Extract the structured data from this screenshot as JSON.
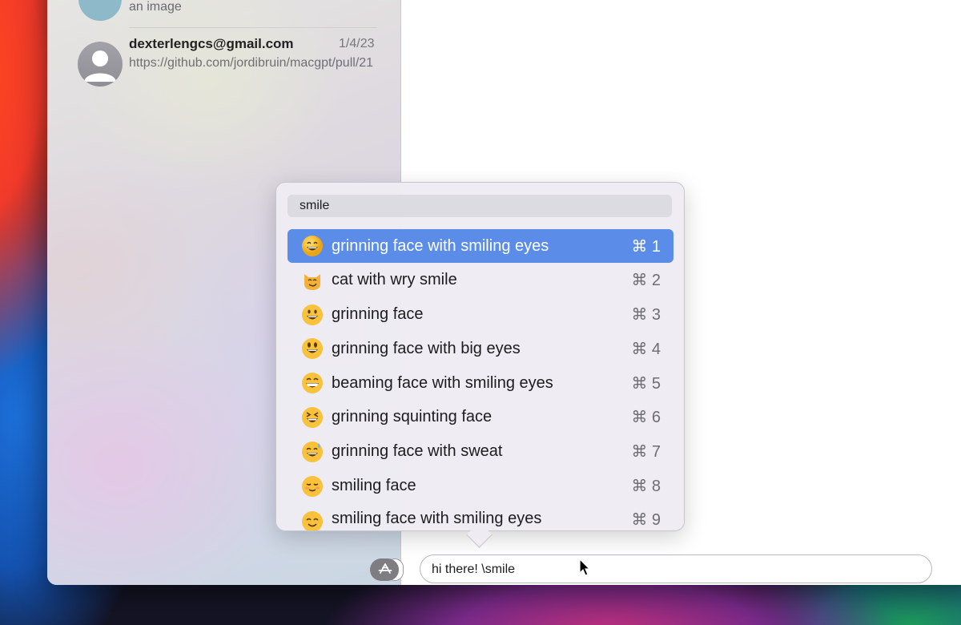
{
  "sidebar": {
    "partial_conversation": {
      "snippet": "an image"
    },
    "conversation": {
      "name": "dexterlengcs@gmail.com",
      "date": "1/4/23",
      "preview": "https://github.com/jordibruin/macgpt/pull/21"
    }
  },
  "emoji_picker": {
    "search_value": "smile",
    "results": [
      {
        "label": "grinning face with smiling eyes",
        "shortcut": "⌘ 1",
        "selected": true,
        "emoji": "grinning-face-with-smiling-eyes"
      },
      {
        "label": "cat with wry smile",
        "shortcut": "⌘ 2",
        "selected": false,
        "emoji": "cat-with-wry-smile"
      },
      {
        "label": "grinning face",
        "shortcut": "⌘ 3",
        "selected": false,
        "emoji": "grinning-face"
      },
      {
        "label": "grinning face with big eyes",
        "shortcut": "⌘ 4",
        "selected": false,
        "emoji": "grinning-face-with-big-eyes"
      },
      {
        "label": "beaming face with smiling eyes",
        "shortcut": "⌘ 5",
        "selected": false,
        "emoji": "beaming-face-with-smiling-eyes"
      },
      {
        "label": "grinning squinting face",
        "shortcut": "⌘ 6",
        "selected": false,
        "emoji": "grinning-squinting-face"
      },
      {
        "label": "grinning face with sweat",
        "shortcut": "⌘ 7",
        "selected": false,
        "emoji": "grinning-face-with-sweat"
      },
      {
        "label": "smiling face",
        "shortcut": "⌘ 8",
        "selected": false,
        "emoji": "smiling-face"
      },
      {
        "label": "smiling face with smiling eyes",
        "shortcut": "⌘ 9",
        "selected": false,
        "emoji": "smiling-face-with-smiling-eyes"
      }
    ],
    "accent_color": "#5b8de8"
  },
  "composer": {
    "message_value": "hi there! \\smile",
    "apps_icon": "app-store-icon"
  }
}
